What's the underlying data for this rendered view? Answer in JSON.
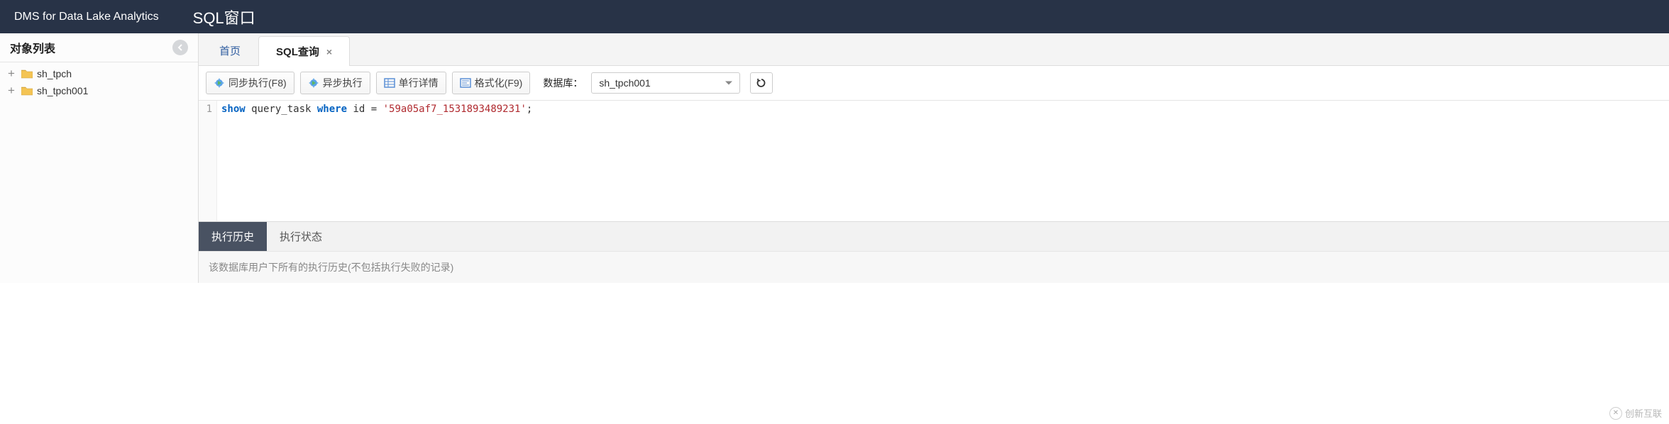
{
  "header": {
    "brand": "DMS for Data Lake Analytics",
    "title": "SQL窗口"
  },
  "sidebar": {
    "title": "对象列表",
    "items": [
      {
        "label": "sh_tpch"
      },
      {
        "label": "sh_tpch001"
      }
    ]
  },
  "tabs": {
    "home": "首页",
    "sql": "SQL查询"
  },
  "toolbar": {
    "sync_exec": "同步执行(F8)",
    "async_exec": "异步执行",
    "row_detail": "单行详情",
    "format": "格式化(F9)",
    "db_label": "数据库：",
    "db_selected": "sh_tpch001"
  },
  "editor": {
    "line_no": "1",
    "kw_show": "show",
    "ident_qt": " query_task ",
    "kw_where": "where",
    "ident_id": " id = ",
    "str_val": "'59a05af7_1531893489231'",
    "semi": ";"
  },
  "bottom": {
    "history": "执行历史",
    "status": "执行状态",
    "hint": "该数据库用户下所有的执行历史(不包括执行失败的记录)"
  },
  "watermark": {
    "text": "创新互联"
  }
}
